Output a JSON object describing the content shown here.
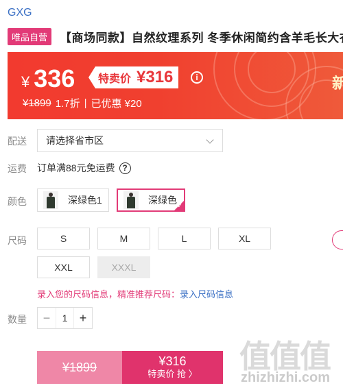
{
  "brand": "GXG",
  "product": {
    "badge": "唯品自营",
    "title": "【商场同款】自然纹理系列 冬季休闲简约含羊毛长大衣"
  },
  "price": {
    "currency": "¥",
    "current": "336",
    "special_label": "特卖价",
    "special_value": "¥316",
    "info_icon": "i",
    "original": "¥1899",
    "discount": "1.7折",
    "separator": "|",
    "saved": "已优惠 ¥20",
    "banner_corner_text": "新"
  },
  "delivery": {
    "label": "配送",
    "placeholder": "请选择省市区"
  },
  "shipping": {
    "label": "运费",
    "text": "订单满88元免运费",
    "help_icon": "?"
  },
  "color": {
    "label": "颜色",
    "options": [
      {
        "name": "深绿色1",
        "selected": false
      },
      {
        "name": "深绿色",
        "selected": true
      }
    ],
    "check_mark": "✓"
  },
  "size": {
    "label": "尺码",
    "options": [
      {
        "name": "S",
        "available": true
      },
      {
        "name": "M",
        "available": true
      },
      {
        "name": "L",
        "available": true
      },
      {
        "name": "XL",
        "available": true
      },
      {
        "name": "XXL",
        "available": true
      },
      {
        "name": "XXXL",
        "available": false
      }
    ]
  },
  "size_hint": {
    "text": "录入您的尺码信息，精准推荐尺码：",
    "link": "录入尺码信息"
  },
  "quantity": {
    "label": "数量",
    "minus": "−",
    "value": "1",
    "plus": "+"
  },
  "buy_bar": {
    "original": "¥1899",
    "price": "¥316",
    "action": "特卖价 抢 〉"
  },
  "watermark": {
    "chars": "值值值",
    "url": "zhizhizhi.com"
  },
  "colors": {
    "accent_pink": "#e23a77",
    "banner_red": "#f23a2f",
    "link_blue": "#3a6fc4"
  }
}
